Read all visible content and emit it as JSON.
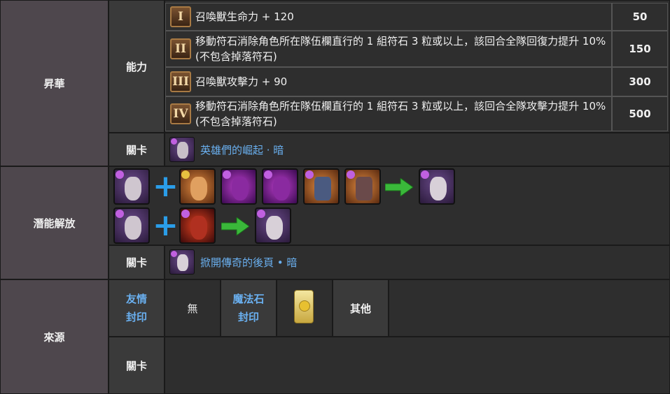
{
  "ascension": {
    "category": "昇華",
    "ability_label": "能力",
    "abilities": [
      {
        "numeral": "I",
        "text": "召喚獸生命力 + 120",
        "cost": "50"
      },
      {
        "numeral": "II",
        "text": "移動符石消除角色所在隊伍欄直行的 1 組符石 3 粒或以上，該回合全隊回復力提升 10% (不包含掉落符石)",
        "cost": "150"
      },
      {
        "numeral": "III",
        "text": "召喚獸攻擊力 + 90",
        "cost": "300"
      },
      {
        "numeral": "IV",
        "text": "移動符石消除角色所在隊伍欄直行的 1 組符石 3 粒或以上，該回合全隊攻擊力提升 10% (不包含掉落符石)",
        "cost": "500"
      }
    ],
    "stage_label": "關卡",
    "stage_name": "英雄們的崛起 · 暗"
  },
  "potential": {
    "category": "潛能解放",
    "stage_label": "關卡",
    "stage_name": "掀開傳奇的後頁 • 暗"
  },
  "source": {
    "category": "來源",
    "friend_seal": "友情\n封印",
    "friend_value": "無",
    "magic_seal": "魔法石\n封印",
    "other": "其他",
    "stage_label": "關卡"
  }
}
